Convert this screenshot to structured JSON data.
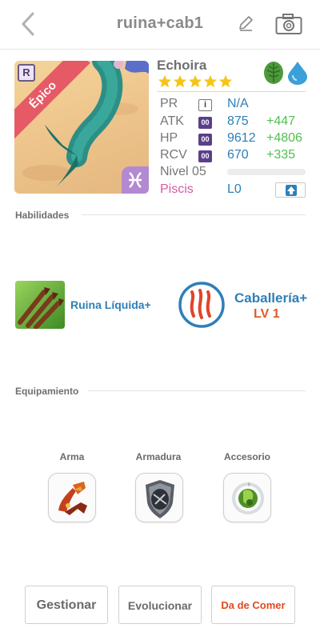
{
  "header": {
    "title": "ruina+cab1",
    "back_icon": "chevron-left-icon",
    "edit_icon": "pencil-icon",
    "camera_icon": "camera-icon"
  },
  "card": {
    "rarity_badge": "R",
    "rarity_label": "Épico",
    "zodiac_icon": "pisces-icon"
  },
  "monster": {
    "name": "Echoira",
    "stars": 5,
    "elements": [
      "leaf-icon",
      "water-drop-icon"
    ]
  },
  "stats": {
    "pr": {
      "label": "PR",
      "box": "i",
      "value": "N/A"
    },
    "atk": {
      "label": "ATK",
      "box": "00",
      "value": "875",
      "bonus": "+447"
    },
    "hp": {
      "label": "HP",
      "box": "00",
      "value": "9612",
      "bonus": "+4806"
    },
    "rcv": {
      "label": "RCV",
      "box": "00",
      "value": "670",
      "bonus": "+335"
    },
    "level": {
      "label": "Nivel 05",
      "progress": 0
    },
    "sign": "Piscis",
    "limit": "L0"
  },
  "sections": {
    "skills": "Habilidades",
    "equipment": "Equipamiento"
  },
  "skills": [
    {
      "name": "Ruina Líquida+"
    },
    {
      "name": "Caballería+",
      "level": "LV 1"
    }
  ],
  "equipment": {
    "weapon": "Arma",
    "armor": "Armadura",
    "accessory": "Accesorio"
  },
  "buttons": {
    "manage": "Gestionar",
    "evolve": "Evolucionar",
    "feed": "Da de Comer"
  },
  "colors": {
    "accent_blue": "#2e7fb8",
    "bonus_green": "#4fbf4f",
    "epic_ribbon": "#e65a66",
    "feed_orange": "#e04a1e",
    "sign_pink": "#d65aa2"
  }
}
